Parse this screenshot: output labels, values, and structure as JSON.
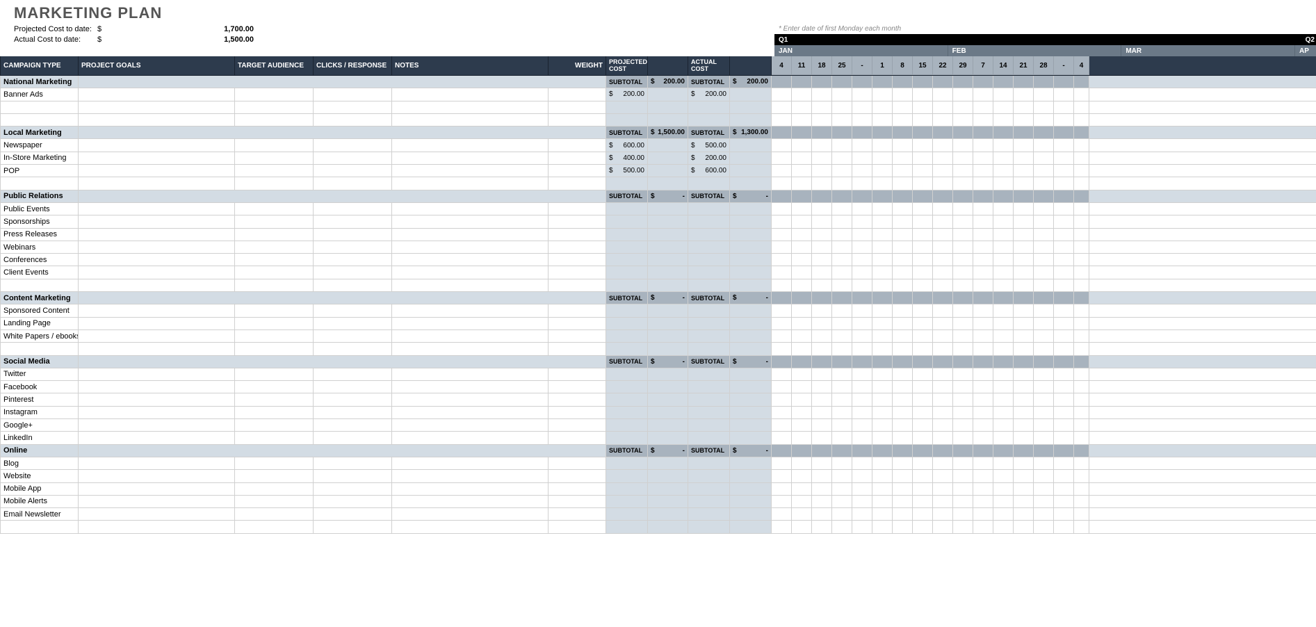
{
  "title": "MARKETING PLAN",
  "summary": {
    "projected_label": "Projected Cost to date:",
    "projected_cur": "$",
    "projected_val": "1,700.00",
    "actual_label": "Actual Cost to date:",
    "actual_cur": "$",
    "actual_val": "1,500.00"
  },
  "calendar": {
    "hint": "* Enter date of first Monday each month",
    "quarter1": "Q1",
    "quarter2": "Q2",
    "months": [
      "JAN",
      "FEB",
      "MAR",
      "AP"
    ],
    "days": [
      "4",
      "11",
      "18",
      "25",
      "-",
      "1",
      "8",
      "15",
      "22",
      "29",
      "7",
      "14",
      "21",
      "28",
      "-",
      "4"
    ]
  },
  "headers": {
    "campaign": "CAMPAIGN TYPE",
    "goals": "PROJECT GOALS",
    "audience": "TARGET AUDIENCE",
    "clicks": "CLICKS / RESPONSE",
    "notes": "NOTES",
    "weight": "WEIGHT",
    "projected": "PROJECTED COST",
    "actual": "ACTUAL COST"
  },
  "subtotal_label": "SUBTOTAL",
  "sections": [
    {
      "name": "National Marketing",
      "proj_sub": "$    200.00",
      "act_sub": "$    200.00",
      "rows": [
        {
          "name": "Banner Ads",
          "proj": "$    200.00",
          "act": "$    200.00"
        },
        {
          "name": "",
          "proj": "",
          "act": ""
        },
        {
          "name": "",
          "proj": "",
          "act": ""
        }
      ]
    },
    {
      "name": "Local Marketing",
      "proj_sub": "$  1,500.00",
      "act_sub": "$  1,300.00",
      "rows": [
        {
          "name": "Newspaper",
          "proj": "$    600.00",
          "act": "$    500.00"
        },
        {
          "name": "In-Store Marketing",
          "proj": "$    400.00",
          "act": "$    200.00"
        },
        {
          "name": "POP",
          "proj": "$    500.00",
          "act": "$    600.00"
        },
        {
          "name": "",
          "proj": "",
          "act": ""
        }
      ]
    },
    {
      "name": "Public Relations",
      "proj_sub": "$          -",
      "act_sub": "$          -",
      "rows": [
        {
          "name": "Public Events",
          "proj": "",
          "act": ""
        },
        {
          "name": "Sponsorships",
          "proj": "",
          "act": ""
        },
        {
          "name": "Press Releases",
          "proj": "",
          "act": ""
        },
        {
          "name": "Webinars",
          "proj": "",
          "act": ""
        },
        {
          "name": "Conferences",
          "proj": "",
          "act": ""
        },
        {
          "name": "Client Events",
          "proj": "",
          "act": ""
        },
        {
          "name": "",
          "proj": "",
          "act": ""
        }
      ]
    },
    {
      "name": "Content Marketing",
      "proj_sub": "$          -",
      "act_sub": "$          -",
      "rows": [
        {
          "name": "Sponsored Content",
          "proj": "",
          "act": ""
        },
        {
          "name": "Landing Page",
          "proj": "",
          "act": ""
        },
        {
          "name": "White Papers / ebooks",
          "proj": "",
          "act": ""
        },
        {
          "name": "",
          "proj": "",
          "act": ""
        }
      ]
    },
    {
      "name": "Social Media",
      "proj_sub": "$          -",
      "act_sub": "$          -",
      "rows": [
        {
          "name": "Twitter",
          "proj": "",
          "act": ""
        },
        {
          "name": "Facebook",
          "proj": "",
          "act": ""
        },
        {
          "name": "Pinterest",
          "proj": "",
          "act": ""
        },
        {
          "name": "Instagram",
          "proj": "",
          "act": ""
        },
        {
          "name": "Google+",
          "proj": "",
          "act": ""
        },
        {
          "name": "LinkedIn",
          "proj": "",
          "act": ""
        }
      ]
    },
    {
      "name": "Online",
      "proj_sub": "$          -",
      "act_sub": "$          -",
      "rows": [
        {
          "name": "Blog",
          "proj": "",
          "act": ""
        },
        {
          "name": "Website",
          "proj": "",
          "act": ""
        },
        {
          "name": "Mobile App",
          "proj": "",
          "act": ""
        },
        {
          "name": "Mobile Alerts",
          "proj": "",
          "act": ""
        },
        {
          "name": "Email Newsletter",
          "proj": "",
          "act": ""
        },
        {
          "name": "",
          "proj": "",
          "act": ""
        }
      ]
    }
  ]
}
